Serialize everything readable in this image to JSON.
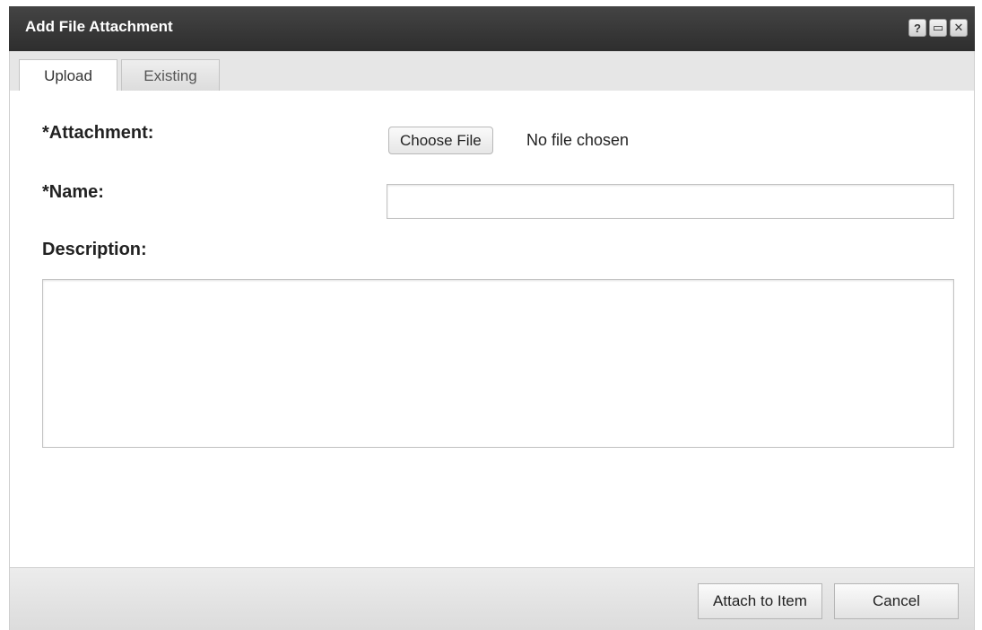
{
  "dialog": {
    "title": "Add File Attachment",
    "title_buttons": {
      "help": "?",
      "maximize": "▭",
      "close": "✕"
    }
  },
  "tabs": [
    {
      "label": "Upload",
      "active": true
    },
    {
      "label": "Existing",
      "active": false
    }
  ],
  "form": {
    "attachment_label": "*Attachment:",
    "choose_file_label": "Choose File",
    "no_file_text": "No file chosen",
    "name_label": "*Name:",
    "name_value": "",
    "description_label": "Description:",
    "description_value": ""
  },
  "footer": {
    "attach_label": "Attach to Item",
    "cancel_label": "Cancel"
  }
}
